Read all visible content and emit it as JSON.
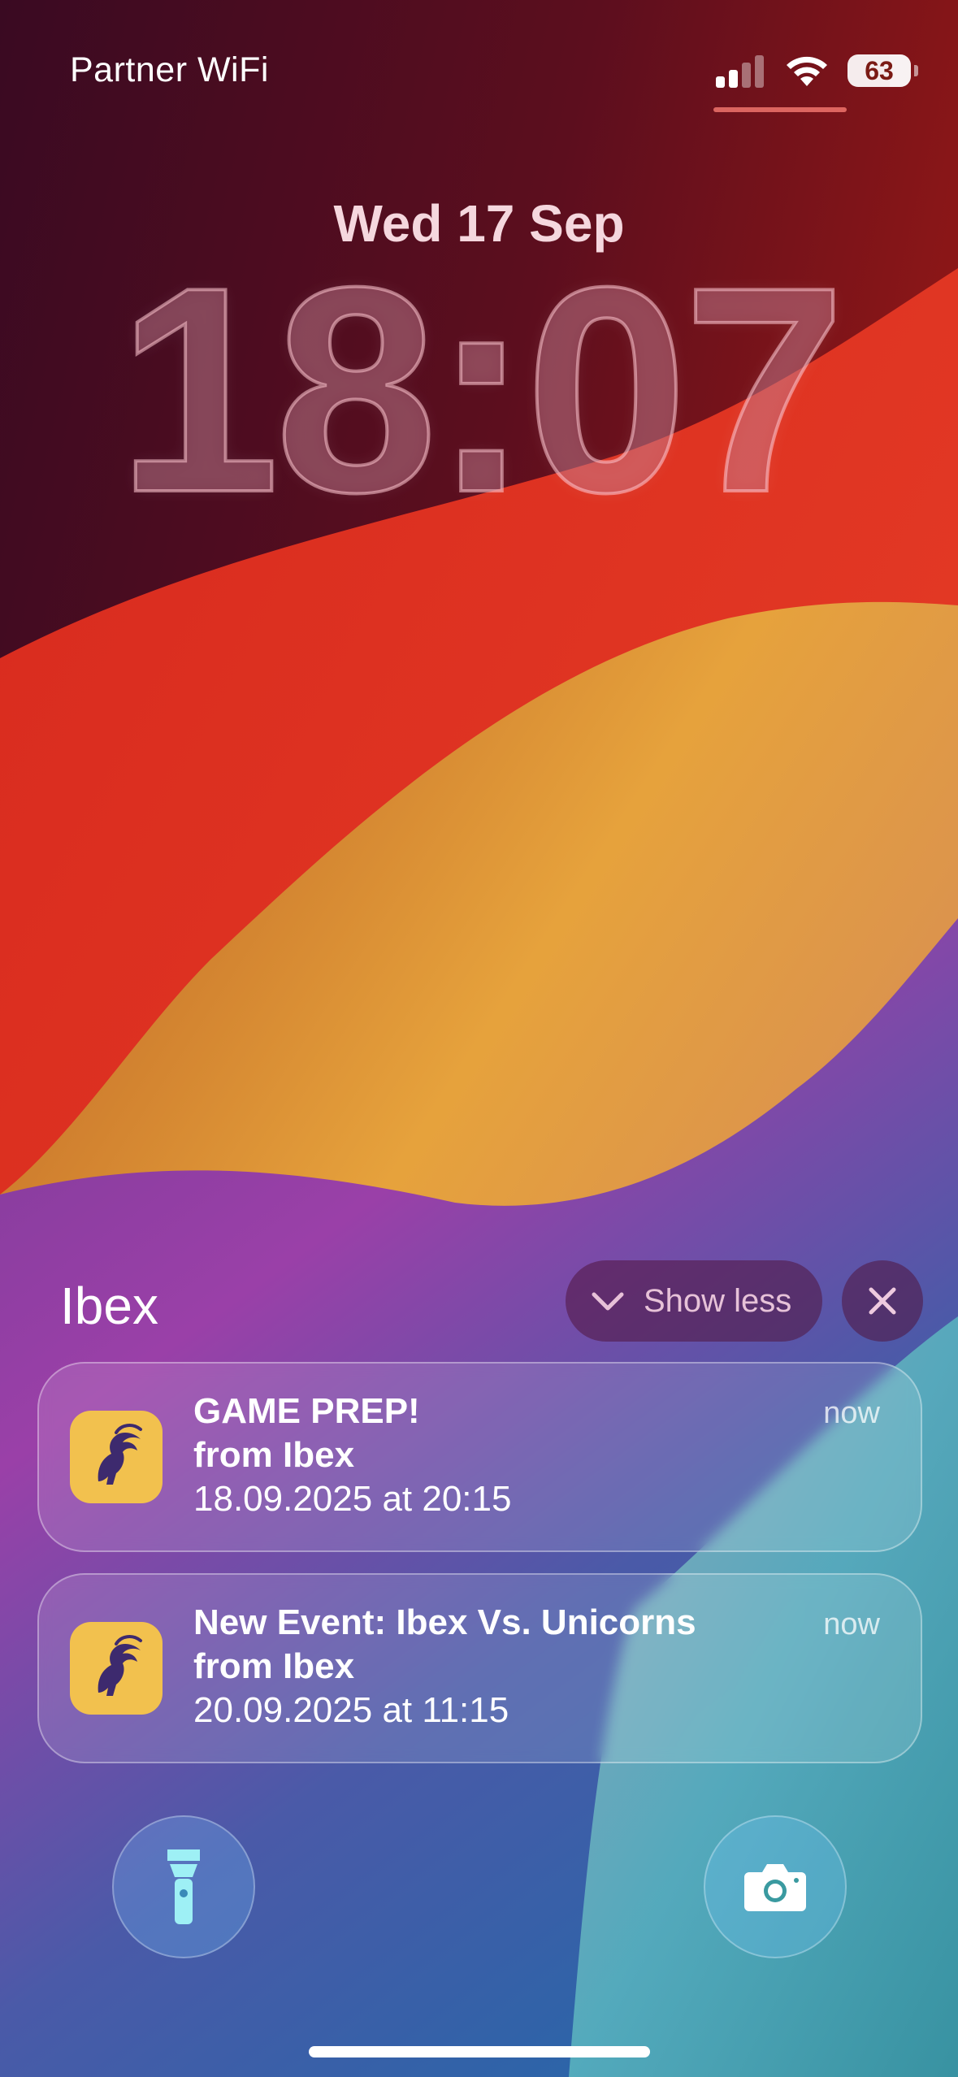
{
  "status_bar": {
    "carrier": "Partner WiFi",
    "battery_percent": "63",
    "signal_bars_active": 2,
    "signal_bars_total": 4,
    "icons": [
      "cellular-signal-icon",
      "wifi-icon",
      "battery-icon"
    ]
  },
  "lock_screen": {
    "date": "Wed 17 Sep",
    "time": "18:07"
  },
  "notification_group": {
    "app_name": "Ibex",
    "show_less_label": "Show less",
    "notifications": [
      {
        "title": "GAME PREP!",
        "subtitle": "from Ibex",
        "body": "18.09.2025 at 20:15",
        "time": "now",
        "icon": "ibex-app-icon"
      },
      {
        "title": "New Event: Ibex Vs. Unicorns",
        "subtitle": "from Ibex",
        "body": "20.09.2025 at 11:15",
        "time": "now",
        "icon": "ibex-app-icon"
      }
    ]
  },
  "quick_actions": {
    "left_icon": "flashlight-icon",
    "right_icon": "camera-icon"
  },
  "colors": {
    "app_icon_bg": "#f2c14e",
    "app_icon_fg": "#3d2a6e"
  }
}
